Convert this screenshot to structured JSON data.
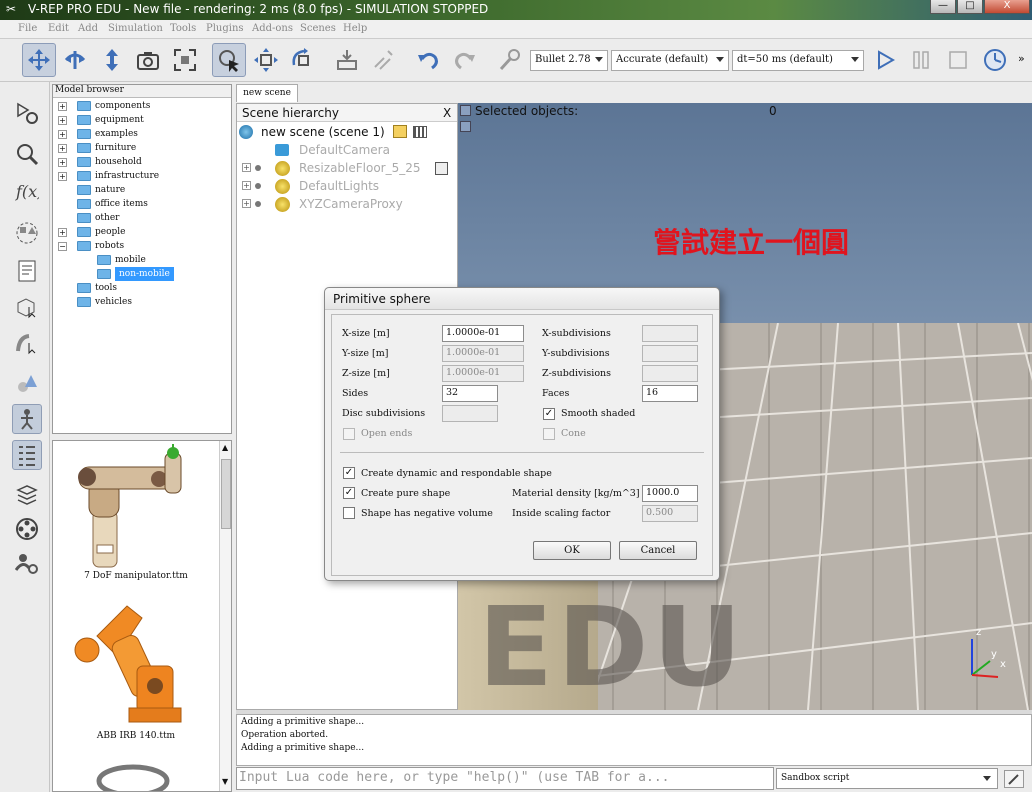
{
  "window": {
    "title": "V-REP PRO EDU - New file - rendering: 2 ms (8.0 fps) - SIMULATION STOPPED",
    "minimize": "—",
    "maximize": "□",
    "close": "X"
  },
  "menu": [
    "File",
    "Edit",
    "Add",
    "Simulation",
    "Tools",
    "Plugins",
    "Add-ons",
    "Scenes",
    "Help"
  ],
  "toolbar": {
    "engine": "Bullet 2.78",
    "accuracy": "Accurate (default)",
    "timestep": "dt=50 ms (default)"
  },
  "model_browser": {
    "title": "Model browser",
    "items": [
      {
        "label": "components",
        "depth": 0,
        "expander": "+"
      },
      {
        "label": "equipment",
        "depth": 0,
        "expander": "+"
      },
      {
        "label": "examples",
        "depth": 0,
        "expander": "+"
      },
      {
        "label": "furniture",
        "depth": 0,
        "expander": "+"
      },
      {
        "label": "household",
        "depth": 0,
        "expander": "+"
      },
      {
        "label": "infrastructure",
        "depth": 0,
        "expander": "+"
      },
      {
        "label": "nature",
        "depth": 0,
        "expander": ""
      },
      {
        "label": "office items",
        "depth": 0,
        "expander": ""
      },
      {
        "label": "other",
        "depth": 0,
        "expander": ""
      },
      {
        "label": "people",
        "depth": 0,
        "expander": "+"
      },
      {
        "label": "robots",
        "depth": 0,
        "expander": "−"
      },
      {
        "label": "mobile",
        "depth": 1,
        "expander": ""
      },
      {
        "label": "non-mobile",
        "depth": 1,
        "expander": "",
        "selected": true
      },
      {
        "label": "tools",
        "depth": 0,
        "expander": ""
      },
      {
        "label": "vehicles",
        "depth": 0,
        "expander": ""
      }
    ]
  },
  "thumbnails": [
    {
      "caption": "7 DoF manipulator.ttm"
    },
    {
      "caption": "ABB IRB 140.ttm"
    }
  ],
  "scene_tab": "new scene",
  "hierarchy": {
    "title": "Scene hierarchy",
    "close": "X",
    "root": "new scene (scene 1)",
    "items": [
      "DefaultCamera",
      "ResizableFloor_5_25",
      "DefaultLights",
      "XYZCameraProxy"
    ]
  },
  "viewport": {
    "selected_label": "Selected objects:",
    "selected_count": "0",
    "watermark": "EDU",
    "annotation": "嘗試建立一個圓",
    "axes": {
      "z": "z",
      "y": "y",
      "x": "x"
    }
  },
  "dialog": {
    "title": "Primitive  sphere",
    "x_size_label": "X-size [m]",
    "x_size": "1.0000e-01",
    "y_size_label": "Y-size [m]",
    "y_size": "1.0000e-01",
    "z_size_label": "Z-size [m]",
    "z_size": "1.0000e-01",
    "sides_label": "Sides",
    "sides": "32",
    "disc_label": "Disc subdivisions",
    "open_ends_label": "Open ends",
    "x_sub_label": "X-subdivisions",
    "y_sub_label": "Y-subdivisions",
    "z_sub_label": "Z-subdivisions",
    "faces_label": "Faces",
    "faces": "16",
    "smooth_label": "Smooth shaded",
    "cone_label": "Cone",
    "dynamic_label": "Create dynamic and respondable shape",
    "pure_label": "Create pure shape",
    "negative_label": "Shape has negative volume",
    "density_label": "Material density [kg/m^3]",
    "density": "1000.0",
    "scaling_label": "Inside scaling factor",
    "scaling": "0.500",
    "ok": "OK",
    "cancel": "Cancel",
    "check": "✓"
  },
  "console": [
    "Adding a primitive shape...",
    "Operation aborted.",
    "Adding a primitive shape..."
  ],
  "lua": {
    "placeholder": "Input Lua code here, or type \"help()\" (use TAB for a...",
    "mode": "Sandbox script"
  },
  "colors": {
    "annotation": "#e0141e",
    "selection": "#3399ff",
    "folder": "#6eb4e8"
  }
}
